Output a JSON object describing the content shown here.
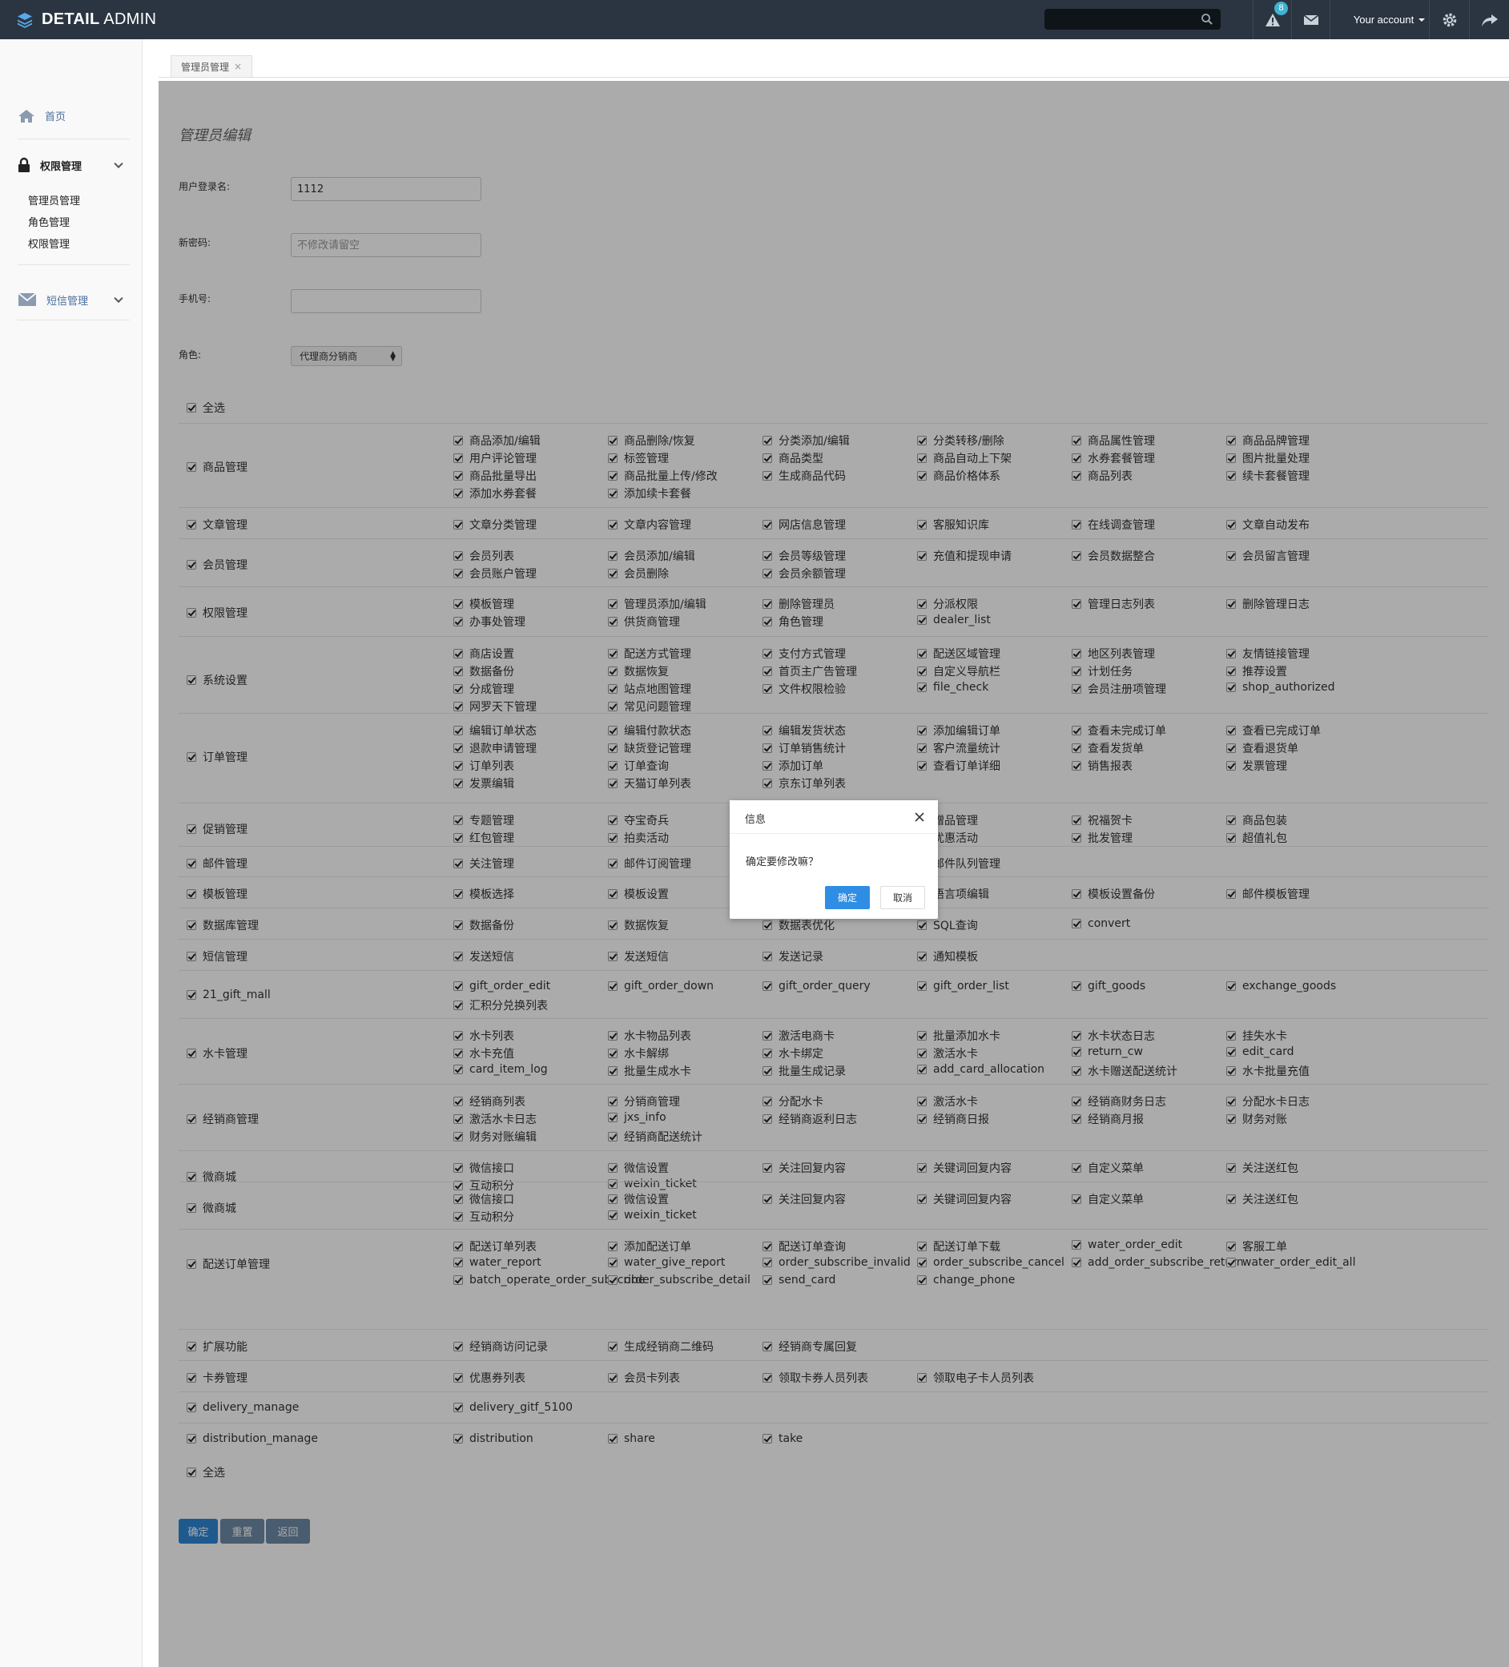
{
  "header": {
    "brand_bold": "DETAIL",
    "brand_light": " ADMIN",
    "notification_count": "8",
    "account_label": "Your account"
  },
  "sidebar": {
    "home": "首页",
    "auth": "权限管理",
    "auth_items": [
      "管理员管理",
      "角色管理",
      "权限管理"
    ],
    "sms": "短信管理"
  },
  "tab": {
    "label": "管理员管理",
    "close": "×"
  },
  "form": {
    "title": "管理员编辑",
    "username_label": "用户登录名:",
    "username_value": "1112",
    "password_label": "新密码:",
    "password_placeholder": "不修改请留空",
    "phone_label": "手机号:",
    "phone_value": "",
    "role_label": "角色:",
    "role_value": "代理商分销商",
    "select_all": "全选"
  },
  "permission_groups": [
    {
      "name": "商品管理",
      "items": [
        "商品添加/编辑",
        "商品删除/恢复",
        "分类添加/编辑",
        "分类转移/删除",
        "商品属性管理",
        "商品品牌管理",
        "用户评论管理",
        "标签管理",
        "商品类型",
        "商品自动上下架",
        "水券套餐管理",
        "图片批量处理",
        "商品批量导出",
        "商品批量上传/修改",
        "生成商品代码",
        "商品价格体系",
        "商品列表",
        "续卡套餐管理",
        "添加水券套餐",
        "添加续卡套餐"
      ]
    },
    {
      "name": "文章管理",
      "items": [
        "文章分类管理",
        "文章内容管理",
        "网店信息管理",
        "客服知识库",
        "在线调查管理",
        "文章自动发布"
      ]
    },
    {
      "name": "会员管理",
      "items": [
        "会员列表",
        "会员添加/编辑",
        "会员等级管理",
        "充值和提现申请",
        "会员数据整合",
        "会员留言管理",
        "会员账户管理",
        "会员删除",
        "会员余额管理"
      ]
    },
    {
      "name": "权限管理",
      "items": [
        "模板管理",
        "管理员添加/编辑",
        "删除管理员",
        "分派权限",
        "管理日志列表",
        "删除管理日志",
        "办事处管理",
        "供货商管理",
        "角色管理",
        "dealer_list"
      ]
    },
    {
      "name": "系统设置",
      "items": [
        "商店设置",
        "配送方式管理",
        "支付方式管理",
        "配送区域管理",
        "地区列表管理",
        "友情链接管理",
        "数据备份",
        "数据恢复",
        "首页主广告管理",
        "自定义导航栏",
        "计划任务",
        "推荐设置",
        "分成管理",
        "站点地图管理",
        "文件权限检验",
        "file_check",
        "会员注册项管理",
        "shop_authorized",
        "网罗天下管理",
        "常见问题管理"
      ]
    },
    {
      "name": "订单管理",
      "items": [
        "编辑订单状态",
        "编辑付款状态",
        "编辑发货状态",
        "添加编辑订单",
        "查看未完成订单",
        "查看已完成订单",
        "退款申请管理",
        "缺货登记管理",
        "订单销售统计",
        "客户流量统计",
        "查看发货单",
        "查看退货单",
        "订单列表",
        "订单查询",
        "添加订单",
        "查看订单详细",
        "销售报表",
        "发票管理",
        "发票编辑",
        "天猫订单列表",
        "京东订单列表"
      ]
    },
    {
      "name": "促销管理",
      "items": [
        "专题管理",
        "夺宝奇兵",
        "",
        "赠品管理",
        "祝福贺卡",
        "商品包装",
        "红包管理",
        "拍卖活动",
        "",
        "优惠活动",
        "批发管理",
        "超值礼包"
      ]
    },
    {
      "name": "邮件管理",
      "items": [
        "关注管理",
        "邮件订阅管理",
        "",
        "邮件队列管理"
      ]
    },
    {
      "name": "模板管理",
      "items": [
        "模板选择",
        "模板设置",
        "",
        "语言项编辑",
        "模板设置备份",
        "邮件模板管理"
      ]
    },
    {
      "name": "数据库管理",
      "items": [
        "数据备份",
        "数据恢复",
        "数据表优化",
        "SQL查询",
        "convert"
      ]
    },
    {
      "name": "短信管理",
      "items": [
        "发送短信",
        "发送短信",
        "发送记录",
        "通知模板"
      ]
    },
    {
      "name": "21_gift_mall",
      "items": [
        "gift_order_edit",
        "gift_order_down",
        "gift_order_query",
        "gift_order_list",
        "gift_goods",
        "exchange_goods",
        "汇积分兑换列表"
      ]
    },
    {
      "name": "水卡管理",
      "items": [
        "水卡列表",
        "水卡物品列表",
        "激活电商卡",
        "批量添加水卡",
        "水卡状态日志",
        "挂失水卡",
        "水卡充值",
        "水卡解绑",
        "水卡绑定",
        "激活水卡",
        "return_cw",
        "edit_card",
        "card_item_log",
        "批量生成水卡",
        "批量生成记录",
        "add_card_allocation",
        "水卡赠送配送统计",
        "水卡批量充值"
      ]
    },
    {
      "name": "经销商管理",
      "items": [
        "经销商列表",
        "分销商管理",
        "分配水卡",
        "激活水卡",
        "经销商财务日志",
        "分配水卡日志",
        "激活水卡日志",
        "jxs_info",
        "经销商返利日志",
        "经销商日报",
        "经销商月报",
        "财务对账",
        "财务对账编辑",
        "经销商配送统计"
      ]
    },
    {
      "name": "微商城",
      "items": [
        "微信接口",
        "微信设置",
        "关注回复内容",
        "关键词回复内容",
        "自定义菜单",
        "关注送红包",
        "互动积分",
        "weixin_ticket"
      ]
    },
    {
      "name": "微商城",
      "items": [
        "微信接口",
        "微信设置",
        "关注回复内容",
        "关键词回复内容",
        "自定义菜单",
        "关注送红包",
        "互动积分",
        "weixin_ticket"
      ]
    },
    {
      "name": "配送订单管理",
      "items": [
        "配送订单列表",
        "添加配送订单",
        "配送订单查询",
        "配送订单下载",
        "water_order_edit",
        "客服工单",
        "water_report",
        "water_give_report",
        "order_subscribe_invalid",
        "order_subscribe_cancel",
        "add_order_subscribe_return",
        "water_order_edit_all",
        "batch_operate_order_subscribe",
        "order_subscribe_detail",
        "send_card",
        "change_phone"
      ]
    },
    {
      "name": "扩展功能",
      "items": [
        "经销商访问记录",
        "生成经销商二维码",
        "经销商专属回复"
      ]
    },
    {
      "name": "卡券管理",
      "items": [
        "优惠券列表",
        "会员卡列表",
        "领取卡券人员列表",
        "领取电子卡人员列表"
      ]
    },
    {
      "name": "delivery_manage",
      "items": [
        "delivery_gitf_5100"
      ]
    },
    {
      "name": "distribution_manage",
      "items": [
        "distribution",
        "share",
        "take"
      ]
    }
  ],
  "buttons": {
    "submit": "确定",
    "reset": "重置",
    "back": "返回"
  },
  "dialog": {
    "title": "信息",
    "message": "确定要修改嘛？",
    "ok": "确定",
    "cancel": "取消"
  }
}
